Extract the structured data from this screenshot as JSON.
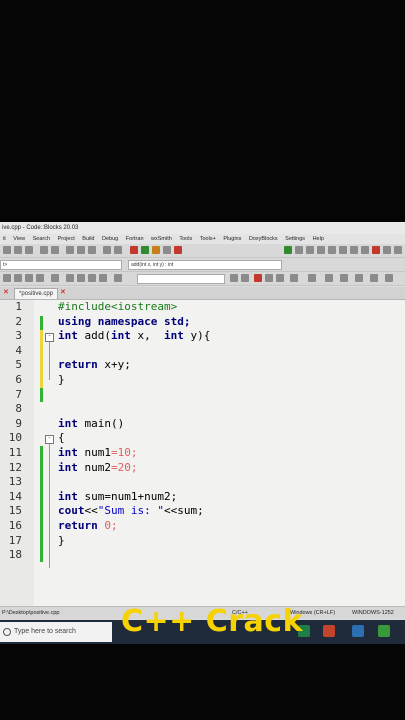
{
  "window": {
    "title": "ive.cpp - Code::Blocks 20.03"
  },
  "menu": [
    "it",
    "View",
    "Search",
    "Project",
    "Build",
    "Debug",
    "Fortran",
    "wxSmith",
    "Tools",
    "Tools+",
    "Plugins",
    "DoxyBlocks",
    "Settings",
    "Help"
  ],
  "toolbar": {
    "function_combo": "add(int x, int y) : int",
    "scope_combo": "t>"
  },
  "tab": {
    "label": "*positive.cpp"
  },
  "code": {
    "l1": "#include<iostream>",
    "l2": "using namespace std;",
    "l3a": "int",
    "l3b": " add(",
    "l3c": "int",
    "l3d": " x,  ",
    "l3e": "int",
    "l3f": " y){",
    "l5a": "return",
    "l5b": " x+y;",
    "l6": "}",
    "l9a": "int",
    "l9b": " main()",
    "l10": "{",
    "l11a": "int",
    "l11b": " num1",
    "l11c": "=",
    "l11d": "10",
    "l11e": ";",
    "l12a": "int",
    "l12b": " num2",
    "l12c": "=",
    "l12d": "20",
    "l12e": ";",
    "l14a": "int",
    "l14b": " sum=num1+num2;",
    "l15a": "cout",
    "l15b": "<<",
    "l15c": "\"Sum is: \"",
    "l15d": "<<sum;",
    "l16a": "return",
    "l16b": " ",
    "l16c": "0",
    "l16d": ";",
    "l17": "}"
  },
  "line_numbers": [
    "1",
    "2",
    "3",
    "4",
    "5",
    "6",
    "7",
    "8",
    "9",
    "10",
    "11",
    "12",
    "13",
    "14",
    "15",
    "16",
    "17",
    "18"
  ],
  "status": {
    "path": "P:\\Desktop\\positive.cpp",
    "lang": "C/C++",
    "eol": "Windows (CR+LF)",
    "encoding": "WINDOWS-1252"
  },
  "taskbar": {
    "search_placeholder": "Type here to search"
  },
  "watermark": "C++ Crack",
  "colors": {
    "keyword": "#00007a",
    "preprocessor": "#1a7a1a",
    "string": "#0000c8",
    "number": "#e06060",
    "watermark": "#f5d200"
  }
}
